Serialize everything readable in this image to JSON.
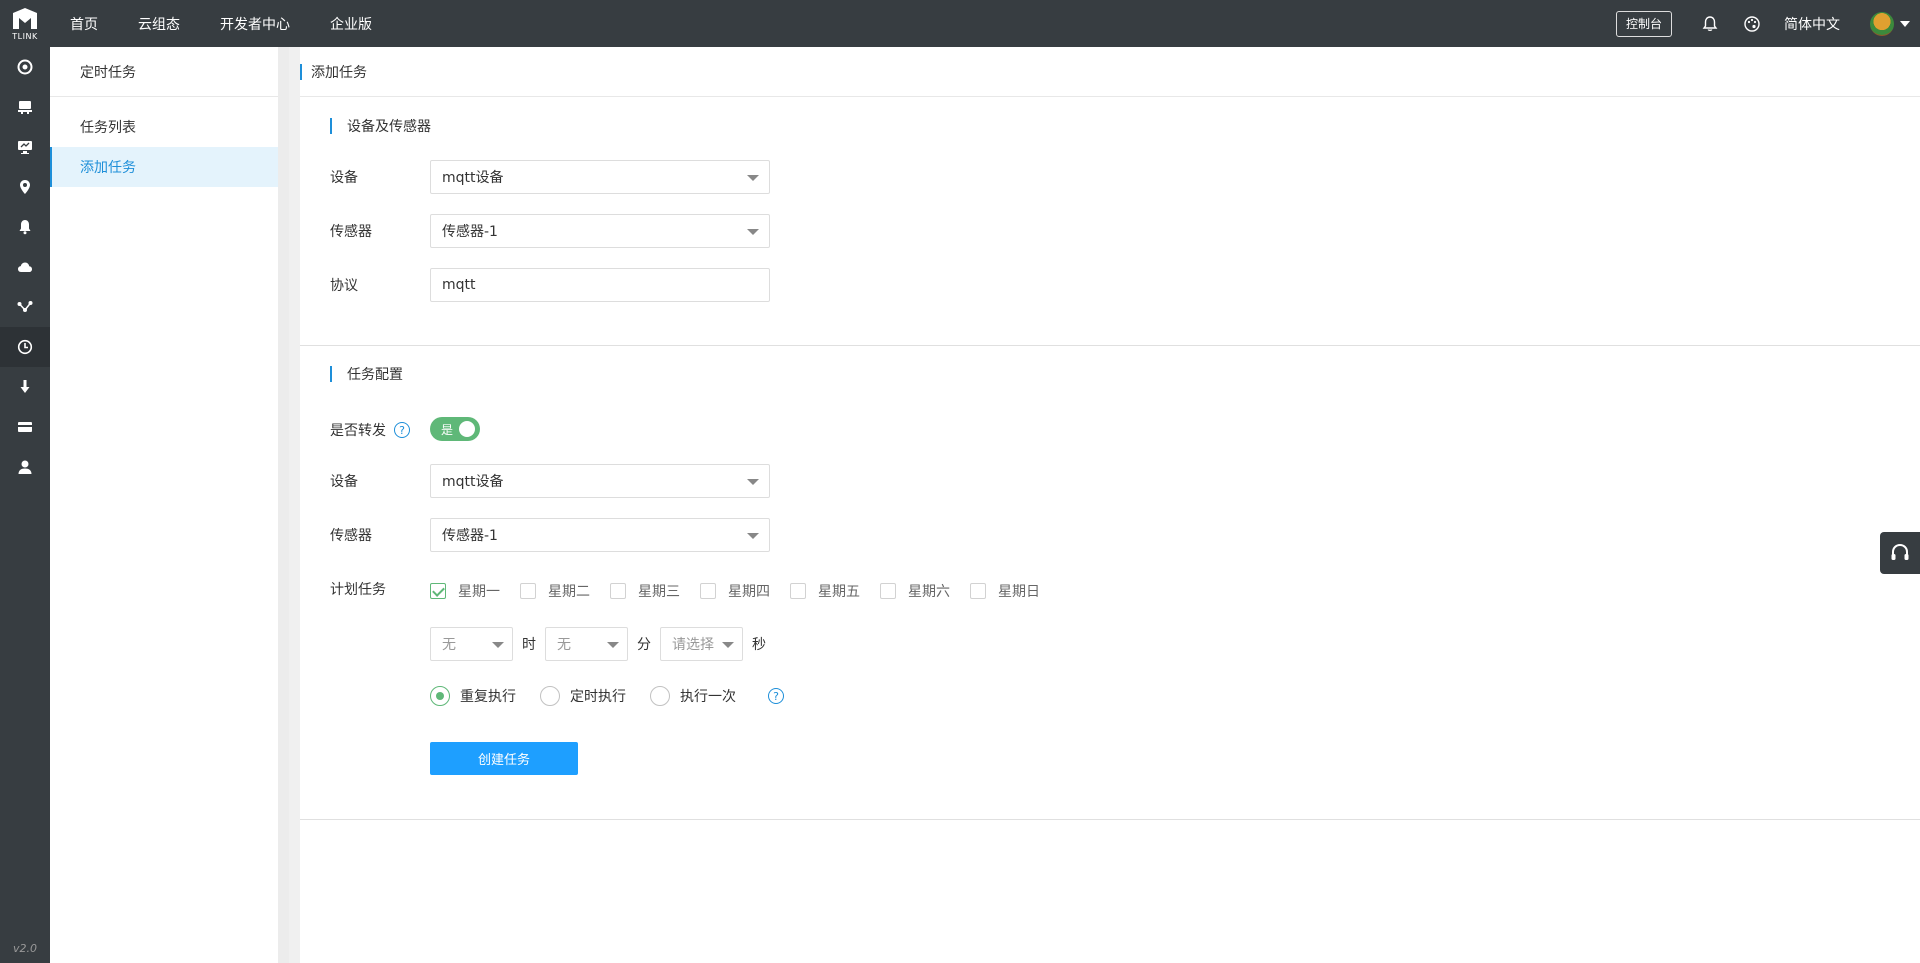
{
  "topbar": {
    "logo_text": "TLINK",
    "nav": [
      "首页",
      "云组态",
      "开发者中心",
      "企业版"
    ],
    "console_label": "控制台",
    "language": "简体中文"
  },
  "version": "v2.0",
  "submenu": {
    "title": "定时任务",
    "items": [
      {
        "label": "任务列表",
        "active": false
      },
      {
        "label": "添加任务",
        "active": true
      }
    ]
  },
  "main": {
    "header_title": "添加任务",
    "device_section": {
      "title": "设备及传感器",
      "device_label": "设备",
      "device_value": "mqtt设备",
      "sensor_label": "传感器",
      "sensor_value": "传感器-1",
      "protocol_label": "协议",
      "protocol_value": "mqtt"
    },
    "task_section": {
      "title": "任务配置",
      "forward_label": "是否转发",
      "forward_switch_text": "是",
      "device_label": "设备",
      "device_value": "mqtt设备",
      "sensor_label": "传感器",
      "sensor_value": "传感器-1",
      "plan_label": "计划任务",
      "weekdays": [
        {
          "label": "星期一",
          "checked": true
        },
        {
          "label": "星期二",
          "checked": false
        },
        {
          "label": "星期三",
          "checked": false
        },
        {
          "label": "星期四",
          "checked": false
        },
        {
          "label": "星期五",
          "checked": false
        },
        {
          "label": "星期六",
          "checked": false
        },
        {
          "label": "星期日",
          "checked": false
        }
      ],
      "hour_value": "无",
      "hour_unit": "时",
      "minute_value": "无",
      "minute_unit": "分",
      "second_value": "请选择",
      "second_unit": "秒",
      "modes": [
        {
          "label": "重复执行",
          "selected": true
        },
        {
          "label": "定时执行",
          "selected": false
        },
        {
          "label": "执行一次",
          "selected": false
        }
      ],
      "create_button": "创建任务"
    }
  },
  "help_icon_char": "?",
  "colors": {
    "nav_bg": "#373d41",
    "primary": "#1e9fff",
    "accent_green": "#5fb878",
    "menu_active_bg": "#e4f3fc"
  }
}
